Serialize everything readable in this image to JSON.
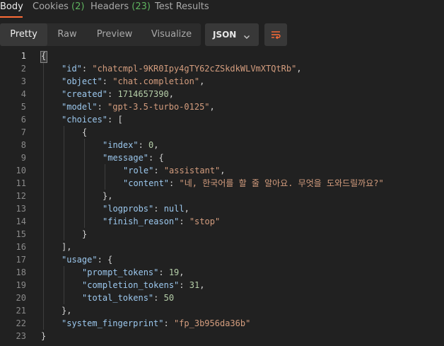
{
  "tabs": {
    "body": "Body",
    "cookies": "Cookies",
    "cookies_count": "(2)",
    "headers": "Headers",
    "headers_count": "(23)",
    "test_results": "Test Results"
  },
  "view": {
    "pretty": "Pretty",
    "raw": "Raw",
    "preview": "Preview",
    "visualize": "Visualize",
    "format": "JSON"
  },
  "line_numbers": [
    "1",
    "2",
    "3",
    "4",
    "5",
    "6",
    "7",
    "8",
    "9",
    "10",
    "11",
    "12",
    "13",
    "14",
    "15",
    "16",
    "17",
    "18",
    "19",
    "20",
    "21",
    "22",
    "23"
  ],
  "json": {
    "open_root": "{",
    "id_key": "\"id\"",
    "id_val": "\"chatcmpl-9KR0Ipy4gTY62cZSkdkWLVmXTQtRb\"",
    "object_key": "\"object\"",
    "object_val": "\"chat.completion\"",
    "created_key": "\"created\"",
    "created_val": "1714657390",
    "model_key": "\"model\"",
    "model_val": "\"gpt-3.5-turbo-0125\"",
    "choices_key": "\"choices\"",
    "open_arr": "[",
    "open_obj": "{",
    "index_key": "\"index\"",
    "index_val": "0",
    "message_key": "\"message\"",
    "role_key": "\"role\"",
    "role_val": "\"assistant\"",
    "content_key": "\"content\"",
    "content_val": "\"네, 한국어를 할 줄 알아요. 무엇을 도와드릴까요?\"",
    "close_obj_comma": "},",
    "logprobs_key": "\"logprobs\"",
    "logprobs_val": "null",
    "finish_key": "\"finish_reason\"",
    "finish_val": "\"stop\"",
    "close_obj": "}",
    "close_arr_comma": "],",
    "usage_key": "\"usage\"",
    "prompt_key": "\"prompt_tokens\"",
    "prompt_val": "19",
    "completion_key": "\"completion_tokens\"",
    "completion_val": "31",
    "total_key": "\"total_tokens\"",
    "total_val": "50",
    "fingerprint_key": "\"system_fingerprint\"",
    "fingerprint_val": "\"fp_3b956da36b\"",
    "close_root": "}"
  },
  "colors": {
    "accent": "#ff6c37",
    "key": "#9cc8ee",
    "string": "#d49d7e",
    "number": "#b5cea8",
    "count": "#5fb35f"
  }
}
